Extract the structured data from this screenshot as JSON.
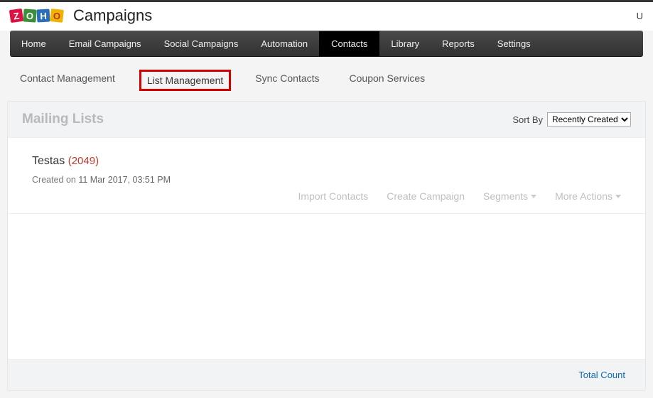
{
  "brand": "Campaigns",
  "topright_initial": "U",
  "mainnav": {
    "home": "Home",
    "email": "Email Campaigns",
    "social": "Social Campaigns",
    "automation": "Automation",
    "contacts": "Contacts",
    "library": "Library",
    "reports": "Reports",
    "settings": "Settings"
  },
  "subnav": {
    "contact_mgmt": "Contact Management",
    "list_mgmt": "List Management",
    "sync": "Sync Contacts",
    "coupon": "Coupon Services"
  },
  "panel": {
    "title": "Mailing Lists",
    "sort_label": "Sort By",
    "sort_selected": "Recently Created"
  },
  "list": {
    "name": "Testas",
    "count_display": "(2049)",
    "created_prefix": "Created on ",
    "created_value": "11 Mar 2017, 03:51 PM"
  },
  "actions": {
    "import": "Import Contacts",
    "create": "Create Campaign",
    "segments": "Segments",
    "more": "More Actions"
  },
  "footer": {
    "total_count": "Total Count"
  }
}
